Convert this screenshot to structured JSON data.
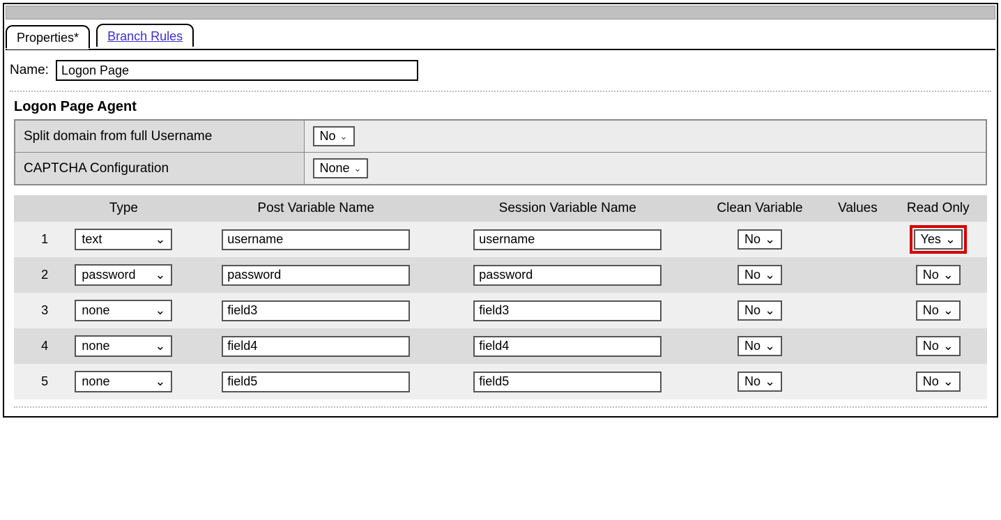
{
  "tabs": {
    "properties_label": "Properties*",
    "branch_rules_label": "Branch Rules"
  },
  "name_field": {
    "label": "Name:",
    "value": "Logon Page"
  },
  "agent_section": {
    "heading": "Logon Page Agent",
    "split_domain_label": "Split domain from full Username",
    "split_domain_value": "No",
    "captcha_label": "CAPTCHA Configuration",
    "captcha_value": "None"
  },
  "fields_table": {
    "headers": {
      "type": "Type",
      "post_var": "Post Variable Name",
      "session_var": "Session Variable Name",
      "clean_var": "Clean Variable",
      "values": "Values",
      "read_only": "Read Only"
    },
    "rows": [
      {
        "idx": "1",
        "type": "text",
        "post": "username",
        "session": "username",
        "clean": "No",
        "values": "",
        "readonly": "Yes",
        "highlight_readonly": true
      },
      {
        "idx": "2",
        "type": "password",
        "post": "password",
        "session": "password",
        "clean": "No",
        "values": "",
        "readonly": "No",
        "highlight_readonly": false
      },
      {
        "idx": "3",
        "type": "none",
        "post": "field3",
        "session": "field3",
        "clean": "No",
        "values": "",
        "readonly": "No",
        "highlight_readonly": false
      },
      {
        "idx": "4",
        "type": "none",
        "post": "field4",
        "session": "field4",
        "clean": "No",
        "values": "",
        "readonly": "No",
        "highlight_readonly": false
      },
      {
        "idx": "5",
        "type": "none",
        "post": "field5",
        "session": "field5",
        "clean": "No",
        "values": "",
        "readonly": "No",
        "highlight_readonly": false
      }
    ]
  }
}
